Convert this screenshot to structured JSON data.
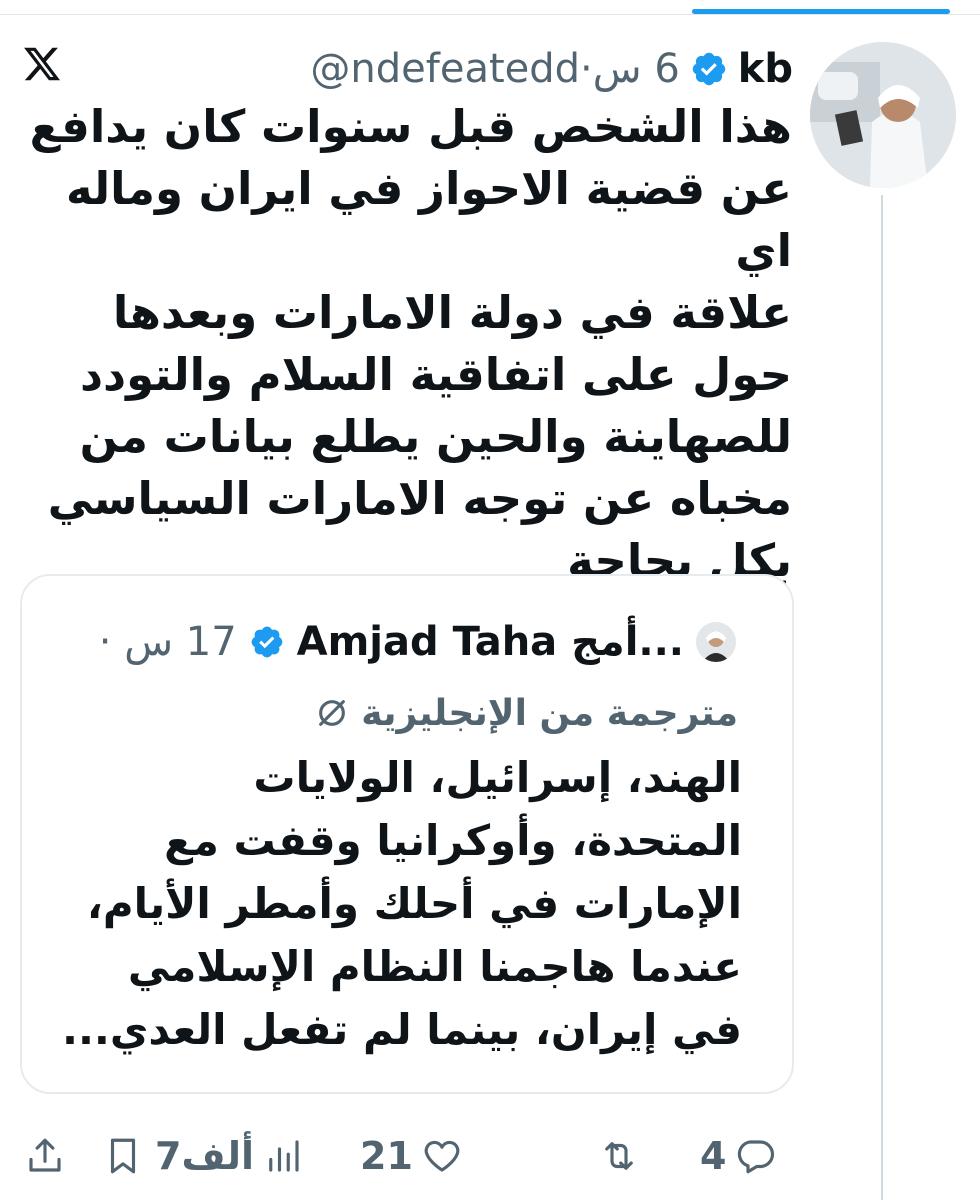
{
  "colors": {
    "accent": "#1d9bf0",
    "text": "#0f1419",
    "muted": "#536471",
    "border": "#e6ebef"
  },
  "tweet": {
    "author_name": "kb",
    "handle": "@ndefeatedd",
    "separator": "·",
    "time": "6 س",
    "text": "هذا الشخص قبل سنوات كان يدافع\nعن قضية الاحواز في ايران وماله اي\nعلاقة في دولة الامارات وبعدها\nحول على اتفاقية السلام والتودد\nللصهاينة والحين يطلع بيانات من\nمخباه عن توجه الامارات السياسي\nبكل بجاحة"
  },
  "quote": {
    "author_name": "Amjad Taha أمج...",
    "separator": "·",
    "time": "17 س",
    "translated_label": "مترجمة من الإنجليزية",
    "text": "الهند، إسرائيل، الولايات\nالمتحدة، وأوكرانيا وقفت مع\nالإمارات في أحلك وأمطر الأيام،\nعندما هاجمنا النظام الإسلامي\nفي إيران، بينما لم تفعل العدي..."
  },
  "actions": {
    "replies": "4",
    "retweets": "",
    "likes": "21",
    "views": "7ألف",
    "icons": [
      "reply-icon",
      "retweet-icon",
      "heart-icon",
      "views-icon",
      "bookmark-icon",
      "share-icon"
    ]
  }
}
